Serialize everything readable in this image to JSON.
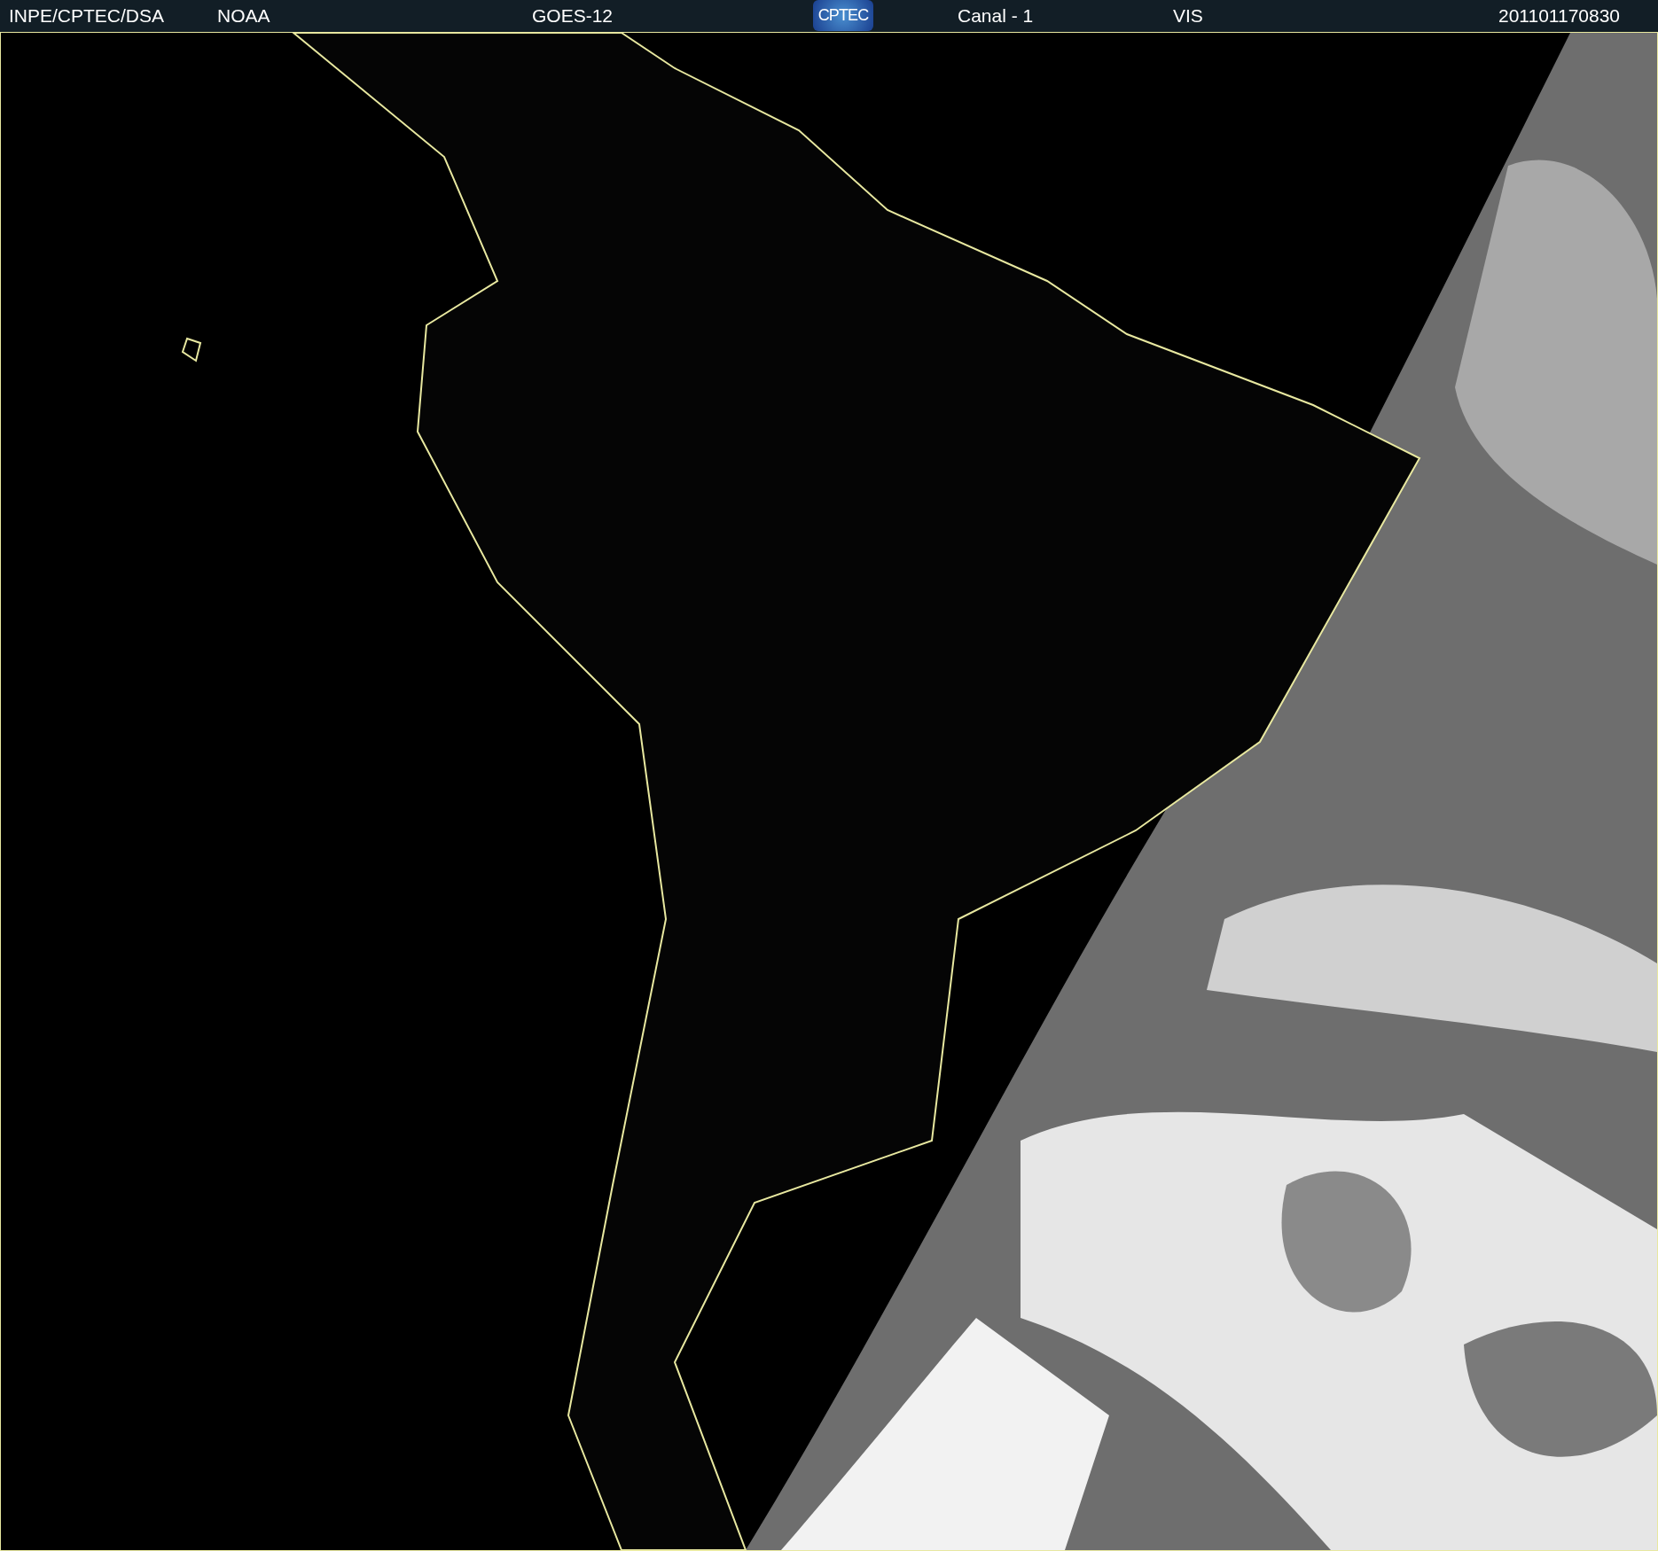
{
  "header": {
    "items": [
      {
        "kind": "text",
        "text": "INPE/CPTEC/DSA"
      },
      {
        "kind": "text",
        "text": "NOAA"
      },
      {
        "kind": "text",
        "text": "GOES-12"
      },
      {
        "kind": "logo",
        "text": "CPTEC"
      },
      {
        "kind": "text",
        "text": "Canal - 1"
      },
      {
        "kind": "text",
        "text": "VIS"
      },
      {
        "kind": "text",
        "text": "201101170830"
      }
    ]
  }
}
